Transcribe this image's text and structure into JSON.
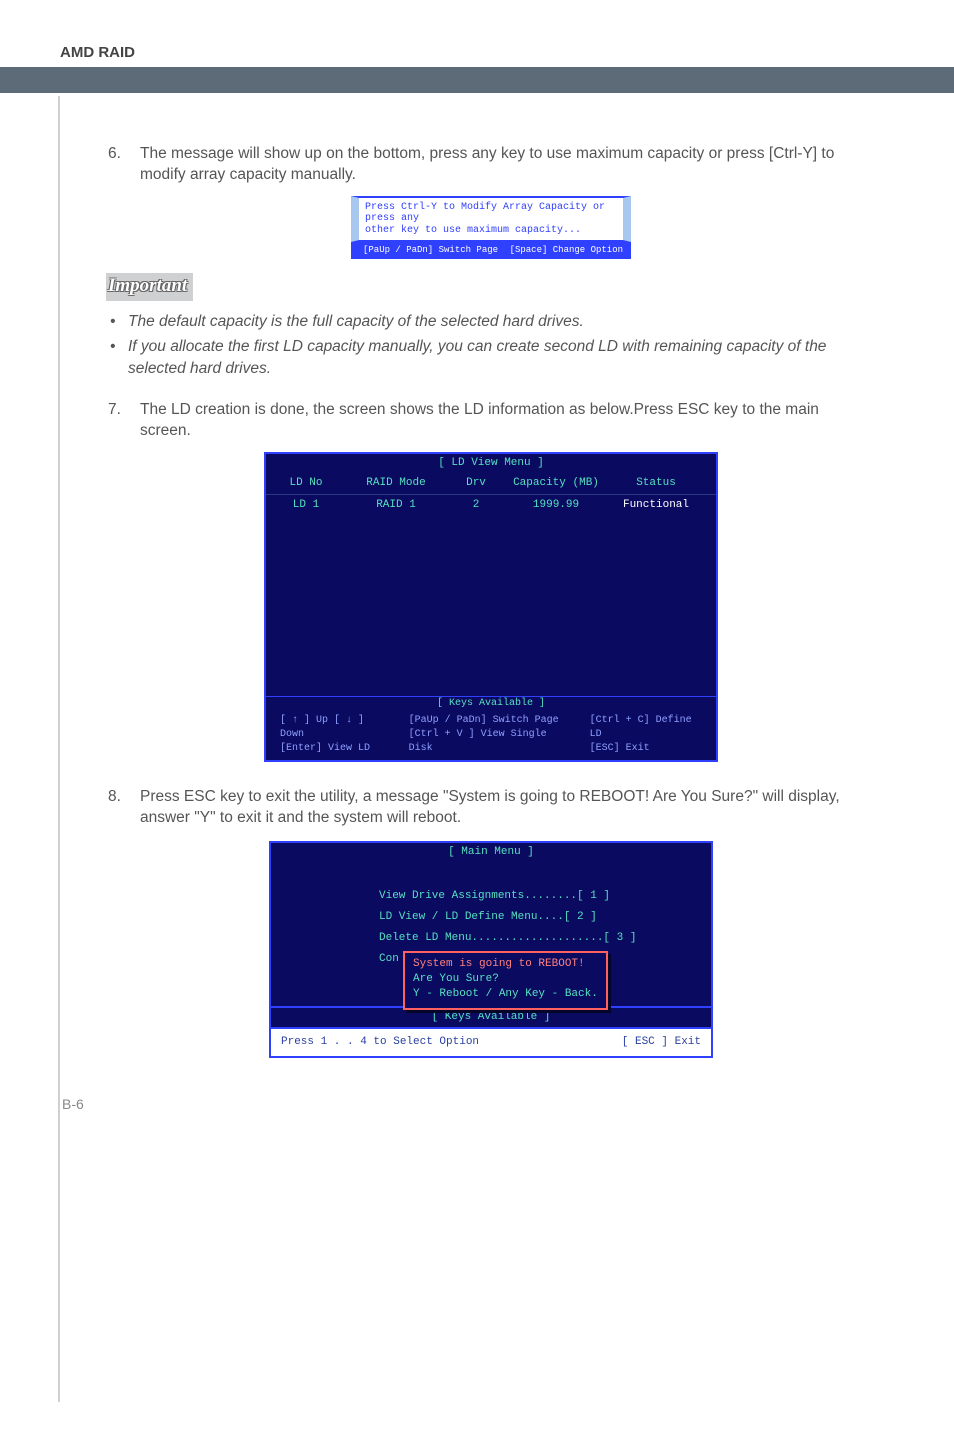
{
  "header": "AMD RAID",
  "step6": {
    "num": "6.",
    "text": "The message will show up on the bottom, press any key to use maximum capacity or press [Ctrl-Y] to modify array capacity manually."
  },
  "msgbox": {
    "line1": "Press Ctrl-Y to Modify Array Capacity or press any",
    "line2": "other key to use maximum capacity...",
    "foot_left": "[PaUp / PaDn] Switch Page",
    "foot_right": "[Space] Change Option"
  },
  "important": {
    "title": "Important",
    "bullets": [
      "The default capacity is the full capacity of the selected hard drives.",
      "If you allocate the first LD capacity manually, you can create second LD with remaining capacity of the selected hard drives."
    ]
  },
  "step7": {
    "num": "7.",
    "text": "The LD creation is done, the screen shows the LD information as below.Press ESC key to the main screen."
  },
  "ldview": {
    "title": "[ LD View Menu ]",
    "headers": {
      "c1": "LD No",
      "c2": "RAID Mode",
      "c3": "Drv",
      "c4": "Capacity (MB)",
      "c5": "Status"
    },
    "row": {
      "c1": "LD   1",
      "c2": "RAID 1",
      "c3": "2",
      "c4": "1999.99",
      "c5": "Functional"
    },
    "keys_title": "[ Keys Available ]",
    "keys_col1a": "[ ↑ ] Up   [ ↓ ] Down",
    "keys_col1b": "[Enter] View LD",
    "keys_col2a": "[PaUp / PaDn] Switch Page",
    "keys_col2b": "[Ctrl + V ] View Single Disk",
    "keys_col3a": "[Ctrl + C] Define LD",
    "keys_col3b": "[ESC] Exit"
  },
  "step8": {
    "num": "8.",
    "text": "Press ESC key to exit the utility, a message \"System is going to REBOOT! Are You Sure?\" will display, answer \"Y\" to exit it and the system will reboot."
  },
  "mainmenu": {
    "title": "[ Main Menu ]",
    "items": [
      "View Drive Assignments........[  1  ]",
      "LD View / LD Define Menu....[  2  ]",
      "Delete LD Menu....................[  3  ]",
      "Con"
    ],
    "reboot": {
      "l1": "System is going to REBOOT!",
      "l2": "Are You Sure?",
      "l3": "Y - Reboot / Any Key - Back."
    },
    "keys_title": "[ Keys Available ]",
    "footer_left": "Press 1 . . 4 to Select Option",
    "footer_right": "[ ESC ]   Exit"
  },
  "page_num": "B-6"
}
